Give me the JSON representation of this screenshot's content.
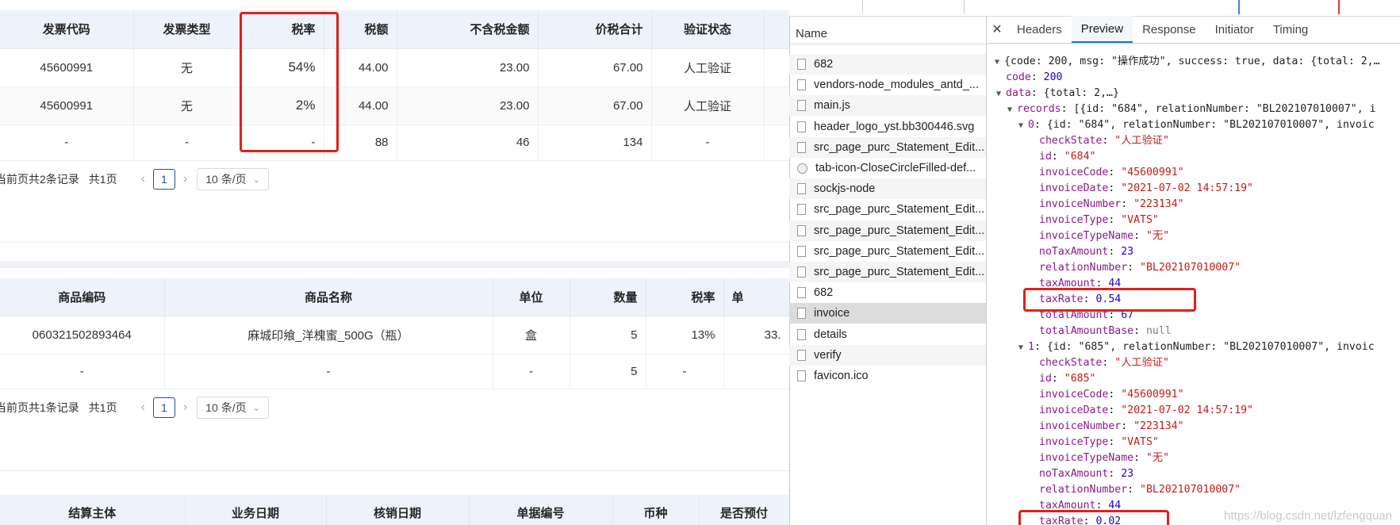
{
  "invoice_table": {
    "headers": [
      "发票代码",
      "发票类型",
      "税率",
      "税额",
      "不含税金额",
      "价税合计",
      "验证状态"
    ],
    "rows": [
      [
        "45600991",
        "无",
        "54%",
        "44.00",
        "23.00",
        "67.00",
        "人工验证"
      ],
      [
        "45600991",
        "无",
        "2%",
        "44.00",
        "23.00",
        "67.00",
        "人工验证"
      ],
      [
        "-",
        "-",
        "-",
        "88",
        "46",
        "134",
        "-"
      ]
    ]
  },
  "invoice_pager": {
    "info": "当前页共2条记录",
    "total": "共1页",
    "page": "1",
    "page_size": "10 条/页"
  },
  "goods_table": {
    "headers": [
      "商品编码",
      "商品名称",
      "单位",
      "数量",
      "税率",
      "单"
    ],
    "rows": [
      [
        "060321502893464",
        "麻城印飨_洋槐蜜_500G（瓶）",
        "盒",
        "5",
        "13%",
        "33."
      ],
      [
        "-",
        "-",
        "-",
        "5",
        "-",
        ""
      ]
    ]
  },
  "goods_pager": {
    "info": "当前页共1条记录",
    "total": "共1页",
    "page": "1",
    "page_size": "10 条/页"
  },
  "settle_table": {
    "headers": [
      "结算主体",
      "业务日期",
      "核销日期",
      "单据编号",
      "币种",
      "是否预付"
    ]
  },
  "devtools": {
    "name_header": "Name",
    "requests": [
      "682",
      "vendors-node_modules_antd_...",
      "main.js",
      "header_logo_yst.bb300446.svg",
      "src_page_purc_Statement_Edit...",
      "tab-icon-CloseCircleFilled-def...",
      "sockjs-node",
      "src_page_purc_Statement_Edit...",
      "src_page_purc_Statement_Edit...",
      "src_page_purc_Statement_Edit...",
      "src_page_purc_Statement_Edit...",
      "682",
      "invoice",
      "details",
      "verify",
      "favicon.ico"
    ],
    "selected_request": "invoice",
    "tabs": [
      "Headers",
      "Preview",
      "Response",
      "Initiator",
      "Timing"
    ],
    "active_tab": "Preview",
    "close_symbol": "✕"
  },
  "json_preview": {
    "root_summary": "{code: 200, msg: \"操作成功\", success: true, data: {total: 2,…",
    "code_key": "code",
    "code_val": "200",
    "data_key": "data",
    "data_summary": "{total: 2,…}",
    "records_key": "records",
    "records_summary": "[{id: \"684\", relationNumber: \"BL202107010007\", i",
    "rec0_summary": "{id: \"684\", relationNumber: \"BL202107010007\", invoic",
    "rec0": [
      [
        "checkState",
        "\"人工验证\""
      ],
      [
        "id",
        "\"684\""
      ],
      [
        "invoiceCode",
        "\"45600991\""
      ],
      [
        "invoiceDate",
        "\"2021-07-02 14:57:19\""
      ],
      [
        "invoiceNumber",
        "\"223134\""
      ],
      [
        "invoiceType",
        "\"VATS\""
      ],
      [
        "invoiceTypeName",
        "\"无\""
      ],
      [
        "noTaxAmount",
        "23"
      ],
      [
        "relationNumber",
        "\"BL202107010007\""
      ],
      [
        "taxAmount",
        "44"
      ],
      [
        "taxRate",
        "0.54"
      ],
      [
        "totalAmount",
        "67"
      ],
      [
        "totalAmountBase",
        "null"
      ]
    ],
    "rec1_summary": "{id: \"685\", relationNumber: \"BL202107010007\", invoic",
    "rec1": [
      [
        "checkState",
        "\"人工验证\""
      ],
      [
        "id",
        "\"685\""
      ],
      [
        "invoiceCode",
        "\"45600991\""
      ],
      [
        "invoiceDate",
        "\"2021-07-02 14:57:19\""
      ],
      [
        "invoiceNumber",
        "\"223134\""
      ],
      [
        "invoiceType",
        "\"VATS\""
      ],
      [
        "invoiceTypeName",
        "\"无\""
      ],
      [
        "noTaxAmount",
        "23"
      ],
      [
        "relationNumber",
        "\"BL202107010007\""
      ],
      [
        "taxAmount",
        "44"
      ],
      [
        "taxRate",
        "0.02"
      ]
    ]
  },
  "watermark": "https://blog.csdn.net/lzfengquan",
  "colors": {
    "highlight": "#e0201b",
    "table_header": "#eef3fb",
    "accent": "#1f4fa3",
    "json_key": "#8a1a8a",
    "json_string": "#c41a16",
    "json_number": "#1c00cf"
  }
}
